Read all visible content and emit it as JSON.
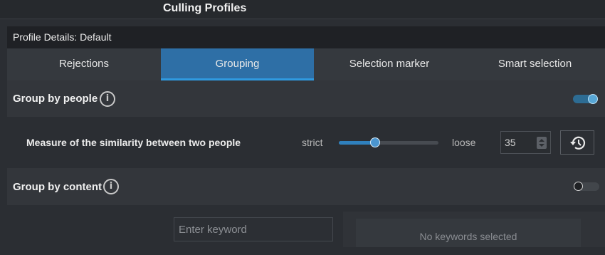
{
  "window": {
    "title": "Culling Profiles"
  },
  "profile": {
    "details_label": "Profile Details: Default"
  },
  "tabs": [
    {
      "label": "Rejections",
      "active": false
    },
    {
      "label": "Grouping",
      "active": true
    },
    {
      "label": "Selection marker",
      "active": false
    },
    {
      "label": "Smart selection",
      "active": false
    }
  ],
  "group_by_people": {
    "label": "Group by people",
    "info_icon": "info-icon",
    "enabled": true
  },
  "similarity": {
    "label": "Measure of the similarity between two people",
    "min_label": "strict",
    "max_label": "loose",
    "value": "35",
    "slider_fraction": 0.36,
    "reset_icon": "history-icon"
  },
  "group_by_content": {
    "label": "Group by content",
    "info_icon": "info-icon",
    "enabled": false
  },
  "keywords": {
    "input_placeholder": "Enter keyword",
    "empty_text": "No keywords selected"
  },
  "colors": {
    "accent": "#2e6fa6",
    "tab_underline": "#2f9ae0",
    "toggle_on": "#58a7d6"
  }
}
